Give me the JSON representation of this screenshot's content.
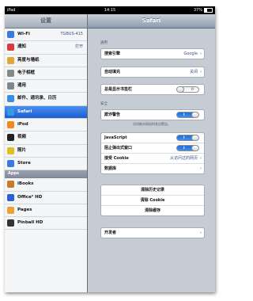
{
  "status": {
    "device": "iPad",
    "time": "14:15",
    "battery": "37%"
  },
  "master": {
    "title": "设置",
    "items": [
      {
        "label": "Wi-Fi",
        "value": "TGBUS-415",
        "icon": "wifi-icon",
        "color": "#3a7be0"
      },
      {
        "label": "通知",
        "value": "打开",
        "icon": "notifications-icon",
        "color": "#d93a3a"
      },
      {
        "label": "亮度与墙纸",
        "value": "",
        "icon": "brightness-icon",
        "color": "#e0a63a"
      },
      {
        "label": "电子相框",
        "value": "",
        "icon": "picture-frame-icon",
        "color": "#888888"
      },
      {
        "label": "通用",
        "value": "",
        "icon": "gear-icon",
        "color": "#7f8890"
      },
      {
        "label": "邮件、通讯录、日历",
        "value": "",
        "icon": "mail-icon",
        "color": "#3a8ee0"
      },
      {
        "label": "Safari",
        "value": "",
        "icon": "compass-icon",
        "color": "#3a9ae0",
        "selected": true
      },
      {
        "label": "iPod",
        "value": "",
        "icon": "ipod-icon",
        "color": "#f08a1e"
      },
      {
        "label": "视频",
        "value": "",
        "icon": "video-icon",
        "color": "#222222"
      },
      {
        "label": "照片",
        "value": "",
        "icon": "sunflower-icon",
        "color": "#e0c020"
      },
      {
        "label": "Store",
        "value": "",
        "icon": "store-icon",
        "color": "#3a7be0"
      }
    ],
    "apps_header": "Apps",
    "apps": [
      {
        "label": "iBooks",
        "icon": "ibooks-icon",
        "color": "#c67a2a"
      },
      {
        "label": "Office² HD",
        "icon": "office-icon",
        "color": "#2a5fd8"
      },
      {
        "label": "Pages",
        "icon": "pages-icon",
        "color": "#f0a030"
      },
      {
        "label": "Pinball HD",
        "icon": "pinball-icon",
        "color": "#333333"
      }
    ]
  },
  "detail": {
    "title": "Safari",
    "general_label": "通用",
    "search_engine": {
      "label": "搜索引擎",
      "value": "Google"
    },
    "autofill": {
      "label": "自动填充",
      "value": "关闭"
    },
    "bookmarks_bar": {
      "label": "总是显示书签栏",
      "toggle": "O"
    },
    "security_label": "安全",
    "fraud_warning": {
      "label": "欺诈警告",
      "toggle": "I"
    },
    "fraud_note": "访问欺诈网站时发出警告。",
    "javascript": {
      "label": "JavaScript",
      "toggle": "I"
    },
    "block_popups": {
      "label": "阻止弹出式窗口",
      "toggle": "I"
    },
    "accept_cookies": {
      "label": "接受 Cookie",
      "value": "从访问过的网页"
    },
    "databases": {
      "label": "数据库"
    },
    "clear_history": "清除历史记录",
    "clear_cookies": "清除 Cookie",
    "clear_cache": "清除缓存",
    "developer": "开发者"
  }
}
